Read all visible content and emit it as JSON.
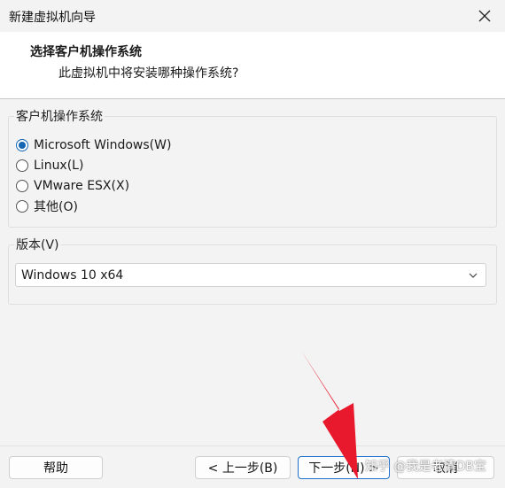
{
  "window": {
    "title": "新建虚拟机向导"
  },
  "header": {
    "title": "选择客户机操作系统",
    "subtitle": "此虚拟机中将安装哪种操作系统?"
  },
  "guest_os": {
    "label": "客户机操作系统",
    "options": [
      {
        "label": "Microsoft Windows(W)",
        "checked": true
      },
      {
        "label": "Linux(L)",
        "checked": false
      },
      {
        "label": "VMware ESX(X)",
        "checked": false
      },
      {
        "label": "其他(O)",
        "checked": false
      }
    ]
  },
  "version": {
    "label": "版本(V)",
    "selected": "Windows 10 x64"
  },
  "buttons": {
    "help": "帮助",
    "back": "< 上一步(B)",
    "next": "下一步(N) >",
    "cancel": "取消"
  },
  "watermark": {
    "text": "知乎 @我是老清DB宝"
  },
  "colors": {
    "accent": "#1464b4",
    "arrow": "#e8192c",
    "header_bg": "#ffffff",
    "body_bg": "#f3f3f3"
  }
}
